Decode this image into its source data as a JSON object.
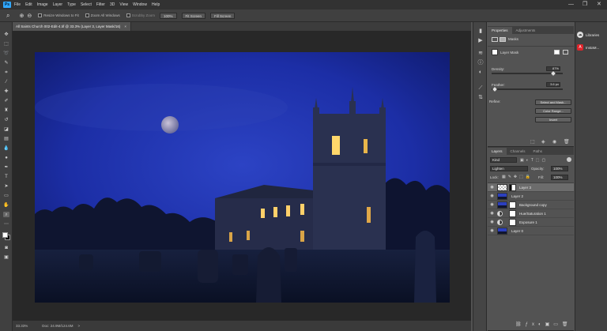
{
  "app": {
    "logo": "Ps",
    "accent": "#31a8ff"
  },
  "menu": [
    "File",
    "Edit",
    "Image",
    "Layer",
    "Type",
    "Select",
    "Filter",
    "3D",
    "View",
    "Window",
    "Help"
  ],
  "window_controls": {
    "minimize": "—",
    "maximize": "❐",
    "close": "✕"
  },
  "options_bar": {
    "resize_windows": "Resize Windows to Fit",
    "zoom_all": "Zoom All Windows",
    "scrubby_zoom": "Scrubby Zoom",
    "btn_100": "100%",
    "fit_screen": "Fit Screen",
    "fill_screen": "Fill Screen"
  },
  "document": {
    "tab_title": "All Saints Church 002-Edit-4.tif @ 33.3% (Layer 3, Layer Mask/16)",
    "tab_close": "×"
  },
  "status": {
    "zoom": "33.33%",
    "doc_size": "Doc: 24.9M/124.6M",
    "arrow": ">"
  },
  "properties": {
    "tabs": [
      "Properties",
      "Adjustments"
    ],
    "section": "Masks",
    "mask_label": "Layer Mask",
    "density_label": "Density:",
    "density_value": "87%",
    "density_level": 0.87,
    "feather_label": "Feather:",
    "feather_value": "3.6 px",
    "feather_level": 0.04,
    "refine_label": "Refine:",
    "btn_select_mask": "Select and Mask...",
    "btn_color_range": "Color Range...",
    "btn_invert": "Invert"
  },
  "layers": {
    "tabs": [
      "Layers",
      "Channels",
      "Paths"
    ],
    "filter_kind": "Kind",
    "blend_mode": "Lighten",
    "opacity_label": "Opacity:",
    "opacity_value": "100%",
    "lock_label": "Lock:",
    "fill_label": "Fill:",
    "fill_value": "100%",
    "rows": [
      {
        "name": "Layer 3",
        "type": "pixel-mask",
        "selected": true
      },
      {
        "name": "Layer 2",
        "type": "pixel",
        "selected": false
      },
      {
        "name": "Background copy",
        "type": "pixel-mask",
        "selected": false
      },
      {
        "name": "Hue/Saturation 1",
        "type": "adjustment",
        "selected": false
      },
      {
        "name": "Exposure 1",
        "type": "adjustment",
        "selected": false
      },
      {
        "name": "Layer 0",
        "type": "pixel",
        "selected": false
      }
    ]
  },
  "libraries": [
    {
      "label": "Libraries",
      "icon": "cloud-icon"
    },
    {
      "label": "InstaM...",
      "icon": "adobe-icon"
    }
  ],
  "icons": {
    "eye": "◉",
    "search": "⌕",
    "zoom_in": "⊕",
    "zoom_out": "⊖"
  }
}
